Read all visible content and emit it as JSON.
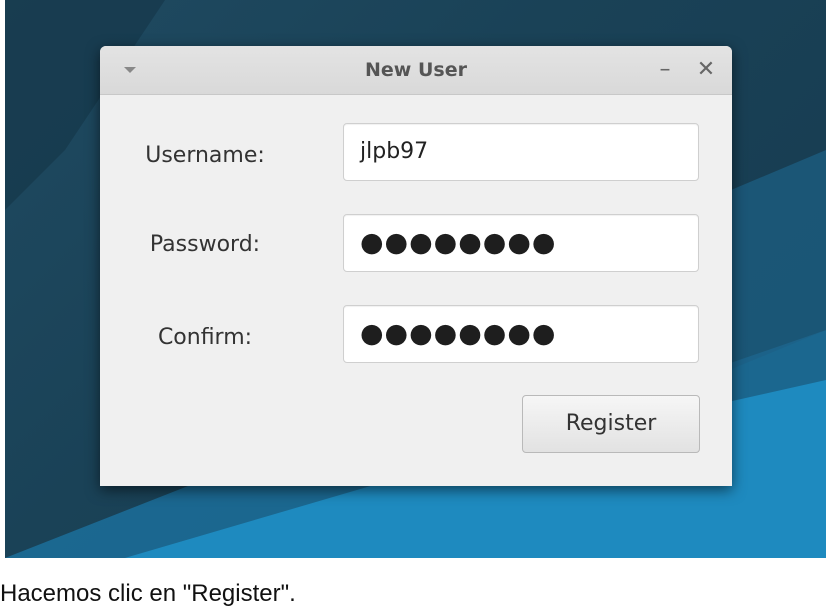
{
  "window": {
    "title": "New User",
    "minimize_glyph": "–",
    "close_glyph": "✕"
  },
  "form": {
    "username_label": "Username:",
    "username_value": "jlpb97",
    "password_label": "Password:",
    "password_value": "●●●●●●●●",
    "confirm_label": "Confirm:",
    "confirm_value": "●●●●●●●●",
    "register_label": "Register"
  },
  "caption": {
    "text": "Hacemos clic en \"Register\"."
  },
  "icons": {
    "window_menu": "chevron-down-icon",
    "minimize": "minimize-icon",
    "close": "close-icon"
  },
  "colors": {
    "wallpaper": "#1a4257",
    "wallpaper_accent": "#1f8ec4",
    "window_bg": "#f0f0f0",
    "titlebar_bg": "#dcdcdc"
  }
}
